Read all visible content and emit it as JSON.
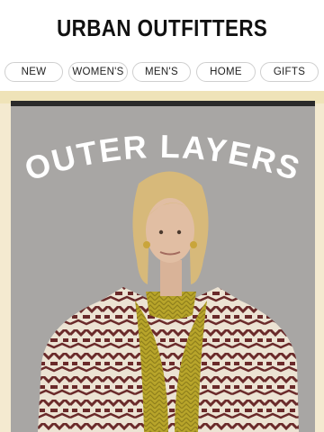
{
  "brand": {
    "name": "URBAN OUTFITTERS"
  },
  "nav": {
    "items": [
      {
        "label": "NEW"
      },
      {
        "label": "WOMEN'S"
      },
      {
        "label": "MEN'S"
      },
      {
        "label": "HOME"
      },
      {
        "label": "GIFTS"
      }
    ]
  },
  "hero": {
    "headline": "OUTER LAYERS",
    "image_desc_icon": "model-photo"
  },
  "colors": {
    "accent_cream": "#f4ead0",
    "backdrop_gray": "#a8a6a4",
    "jacket_cream": "#ece3d3",
    "jacket_pattern": "#6a2a2a",
    "sweater_yellow": "#b8a52a"
  }
}
